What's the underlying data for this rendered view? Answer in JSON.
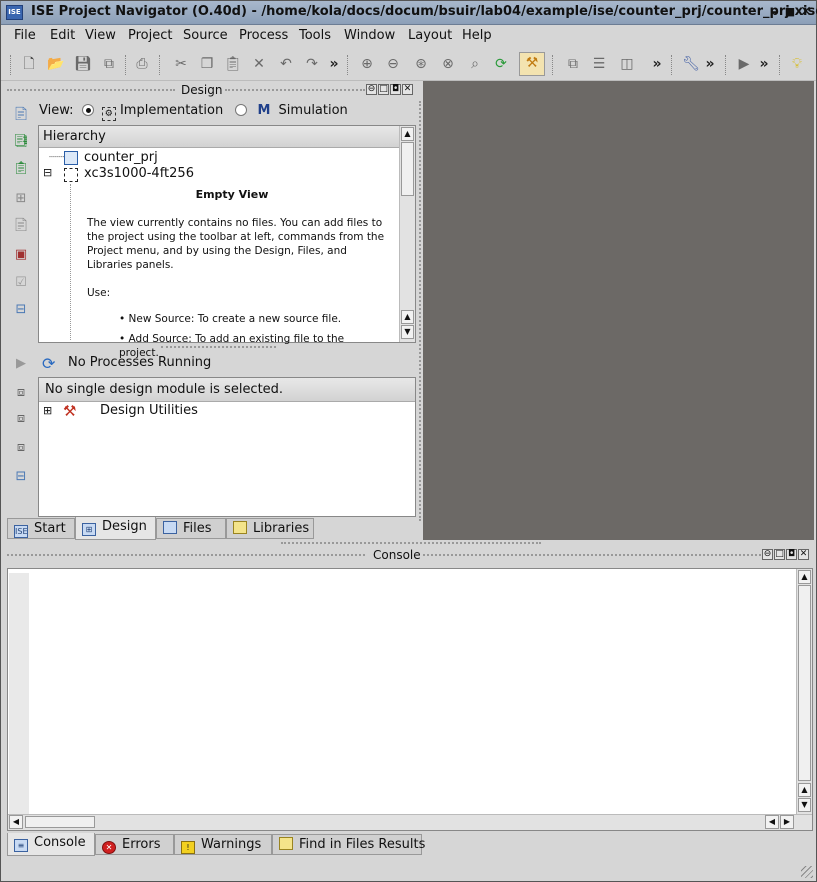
{
  "window": {
    "title": "ISE Project Navigator (O.40d) - /home/kola/docs/docum/bsuir/lab04/example/ise/counter_prj/counter_prj.xise",
    "app_icon_text": "ISE"
  },
  "menu": [
    "File",
    "Edit",
    "View",
    "Project",
    "Source",
    "Process",
    "Tools",
    "Window",
    "Layout",
    "Help"
  ],
  "design_panel": {
    "title": "Design",
    "view_label": "View:",
    "view_options": [
      "Implementation",
      "Simulation"
    ],
    "selected_view": "Implementation",
    "hierarchy_header": "Hierarchy",
    "tree": [
      "counter_prj",
      "xc3s1000-4ft256"
    ],
    "empty_view": {
      "title": "Empty View",
      "body": "The view currently contains no files. You can add files to the project using the toolbar at left, commands from the Project menu, and by using the Design, Files, and Libraries panels.",
      "use_label": "Use:",
      "bullets": [
        "New Source: To create a new source file.",
        "Add Source: To add an existing file to the project."
      ]
    },
    "process_status": "No Processes Running",
    "process_header": "No single design module is selected.",
    "process_items": [
      "Design Utilities"
    ]
  },
  "left_tabs": [
    "Start",
    "Design",
    "Files",
    "Libraries"
  ],
  "selected_left_tab": "Design",
  "console": {
    "title": "Console"
  },
  "bottom_tabs": [
    "Console",
    "Errors",
    "Warnings",
    "Find in Files Results"
  ],
  "selected_bottom_tab": "Console",
  "colors": {
    "workspace": "#6c6966",
    "title_bar": "#9aabc2",
    "chrome": "#d6d6d6"
  }
}
